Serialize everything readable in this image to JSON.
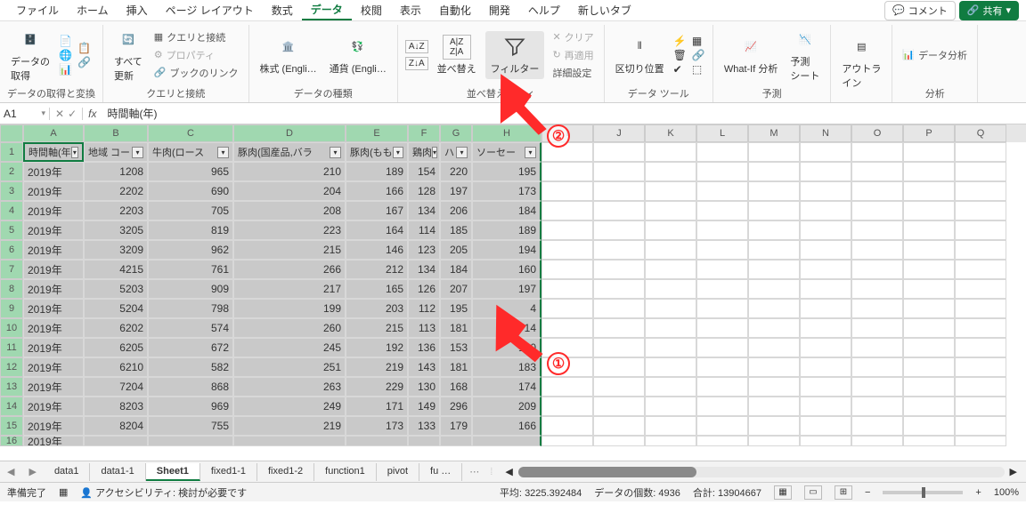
{
  "menu": {
    "tabs": [
      "ファイル",
      "ホーム",
      "挿入",
      "ページ レイアウト",
      "数式",
      "データ",
      "校閲",
      "表示",
      "自動化",
      "開発",
      "ヘルプ",
      "新しいタブ"
    ],
    "active_index": 5,
    "comment_btn": "コメント",
    "share_btn": "共有"
  },
  "ribbon": {
    "groups": {
      "get": {
        "label": "データの取得と変換",
        "btn": "データの\n取得"
      },
      "query": {
        "label": "クエリと接続",
        "refresh": "すべて\n更新",
        "q1": "クエリと接続",
        "q2": "プロパティ",
        "q3": "ブックのリンク"
      },
      "types": {
        "label": "データの種類",
        "stock": "株式 (Engli…",
        "currency": "通貨 (Engli…"
      },
      "sort": {
        "label": "並べ替えとフィ",
        "sort_btn": "並べ替え",
        "filter_btn": "フィルター",
        "clear": "クリア",
        "reapply": "再適用",
        "adv": "詳細設定"
      },
      "tools": {
        "label": "データ ツール",
        "split": "区切り位置"
      },
      "forecast": {
        "label": "予測",
        "whatif": "What-If 分析",
        "sheet": "予測\nシート"
      },
      "outline": {
        "label": "アウトラ\nイン"
      },
      "analysis": {
        "label": "分析",
        "btn": "データ分析"
      }
    }
  },
  "namebox": "A1",
  "formula": "時間軸(年)",
  "columns": [
    "A",
    "B",
    "C",
    "D",
    "E",
    "F",
    "G",
    "H",
    "I",
    "J",
    "K",
    "L",
    "M",
    "N",
    "O",
    "P",
    "Q"
  ],
  "headers": [
    "時間軸(年",
    "地域 コー",
    "牛肉(ロース",
    "豚肉(国産品,バラ",
    "豚肉(もも",
    "鶏肉",
    "ハ",
    "ソーセー"
  ],
  "rows": [
    [
      "2019年",
      "1208",
      "965",
      "210",
      "189",
      "154",
      "220",
      "195"
    ],
    [
      "2019年",
      "2202",
      "690",
      "204",
      "166",
      "128",
      "197",
      "173"
    ],
    [
      "2019年",
      "2203",
      "705",
      "208",
      "167",
      "134",
      "206",
      "184"
    ],
    [
      "2019年",
      "3205",
      "819",
      "223",
      "164",
      "114",
      "185",
      "189"
    ],
    [
      "2019年",
      "3209",
      "962",
      "215",
      "146",
      "123",
      "205",
      "194"
    ],
    [
      "2019年",
      "4215",
      "761",
      "266",
      "212",
      "134",
      "184",
      "160"
    ],
    [
      "2019年",
      "5203",
      "909",
      "217",
      "165",
      "126",
      "207",
      "197"
    ],
    [
      "2019年",
      "5204",
      "798",
      "199",
      "203",
      "112",
      "195",
      "4"
    ],
    [
      "2019年",
      "6202",
      "574",
      "260",
      "215",
      "113",
      "181",
      "14"
    ],
    [
      "2019年",
      "6205",
      "672",
      "245",
      "192",
      "136",
      "153",
      "190"
    ],
    [
      "2019年",
      "6210",
      "582",
      "251",
      "219",
      "143",
      "181",
      "183"
    ],
    [
      "2019年",
      "7204",
      "868",
      "263",
      "229",
      "130",
      "168",
      "174"
    ],
    [
      "2019年",
      "8203",
      "969",
      "249",
      "171",
      "149",
      "296",
      "209"
    ],
    [
      "2019年",
      "8204",
      "755",
      "219",
      "173",
      "133",
      "179",
      "166"
    ]
  ],
  "sheets": {
    "list": [
      "data1",
      "data1-1",
      "Sheet1",
      "fixed1-1",
      "fixed1-2",
      "function1",
      "pivot",
      "fu …"
    ],
    "active_index": 2
  },
  "status": {
    "ready": "準備完了",
    "access": "アクセシビリティ: 検討が必要です",
    "avg_label": "平均:",
    "avg": "3225.392484",
    "count_label": "データの個数:",
    "count": "4936",
    "sum_label": "合計:",
    "sum": "13904667",
    "zoom": "100%"
  },
  "annot": {
    "one": "①",
    "two": "②"
  }
}
